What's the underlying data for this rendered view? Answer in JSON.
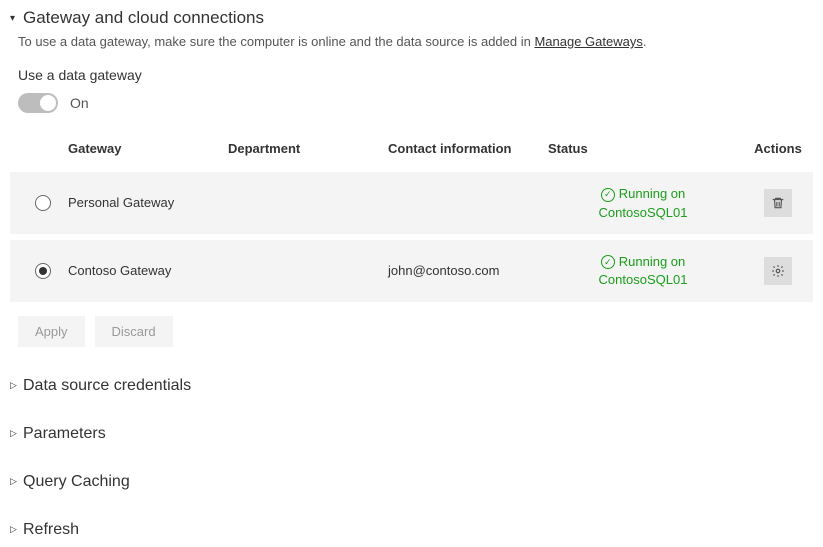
{
  "header": {
    "title": "Gateway and cloud connections",
    "help_prefix": "To use a data gateway, make sure the computer is online and the data source is added in ",
    "help_link": "Manage Gateways",
    "help_suffix": "."
  },
  "toggle": {
    "label": "Use a data gateway",
    "state": "On"
  },
  "table": {
    "headers": {
      "gateway": "Gateway",
      "department": "Department",
      "contact": "Contact information",
      "status": "Status",
      "actions": "Actions"
    },
    "rows": [
      {
        "selected": false,
        "gateway": "Personal Gateway",
        "department": "",
        "contact": "",
        "status_line1": "Running on",
        "status_line2": "ContosoSQL01",
        "action": "delete"
      },
      {
        "selected": true,
        "gateway": "Contoso Gateway",
        "department": "",
        "contact": "john@contoso.com",
        "status_line1": "Running on",
        "status_line2": "ContosoSQL01",
        "action": "settings"
      }
    ]
  },
  "buttons": {
    "apply": "Apply",
    "discard": "Discard"
  },
  "sections": {
    "credentials": "Data source credentials",
    "parameters": "Parameters",
    "caching": "Query Caching",
    "refresh": "Refresh"
  }
}
